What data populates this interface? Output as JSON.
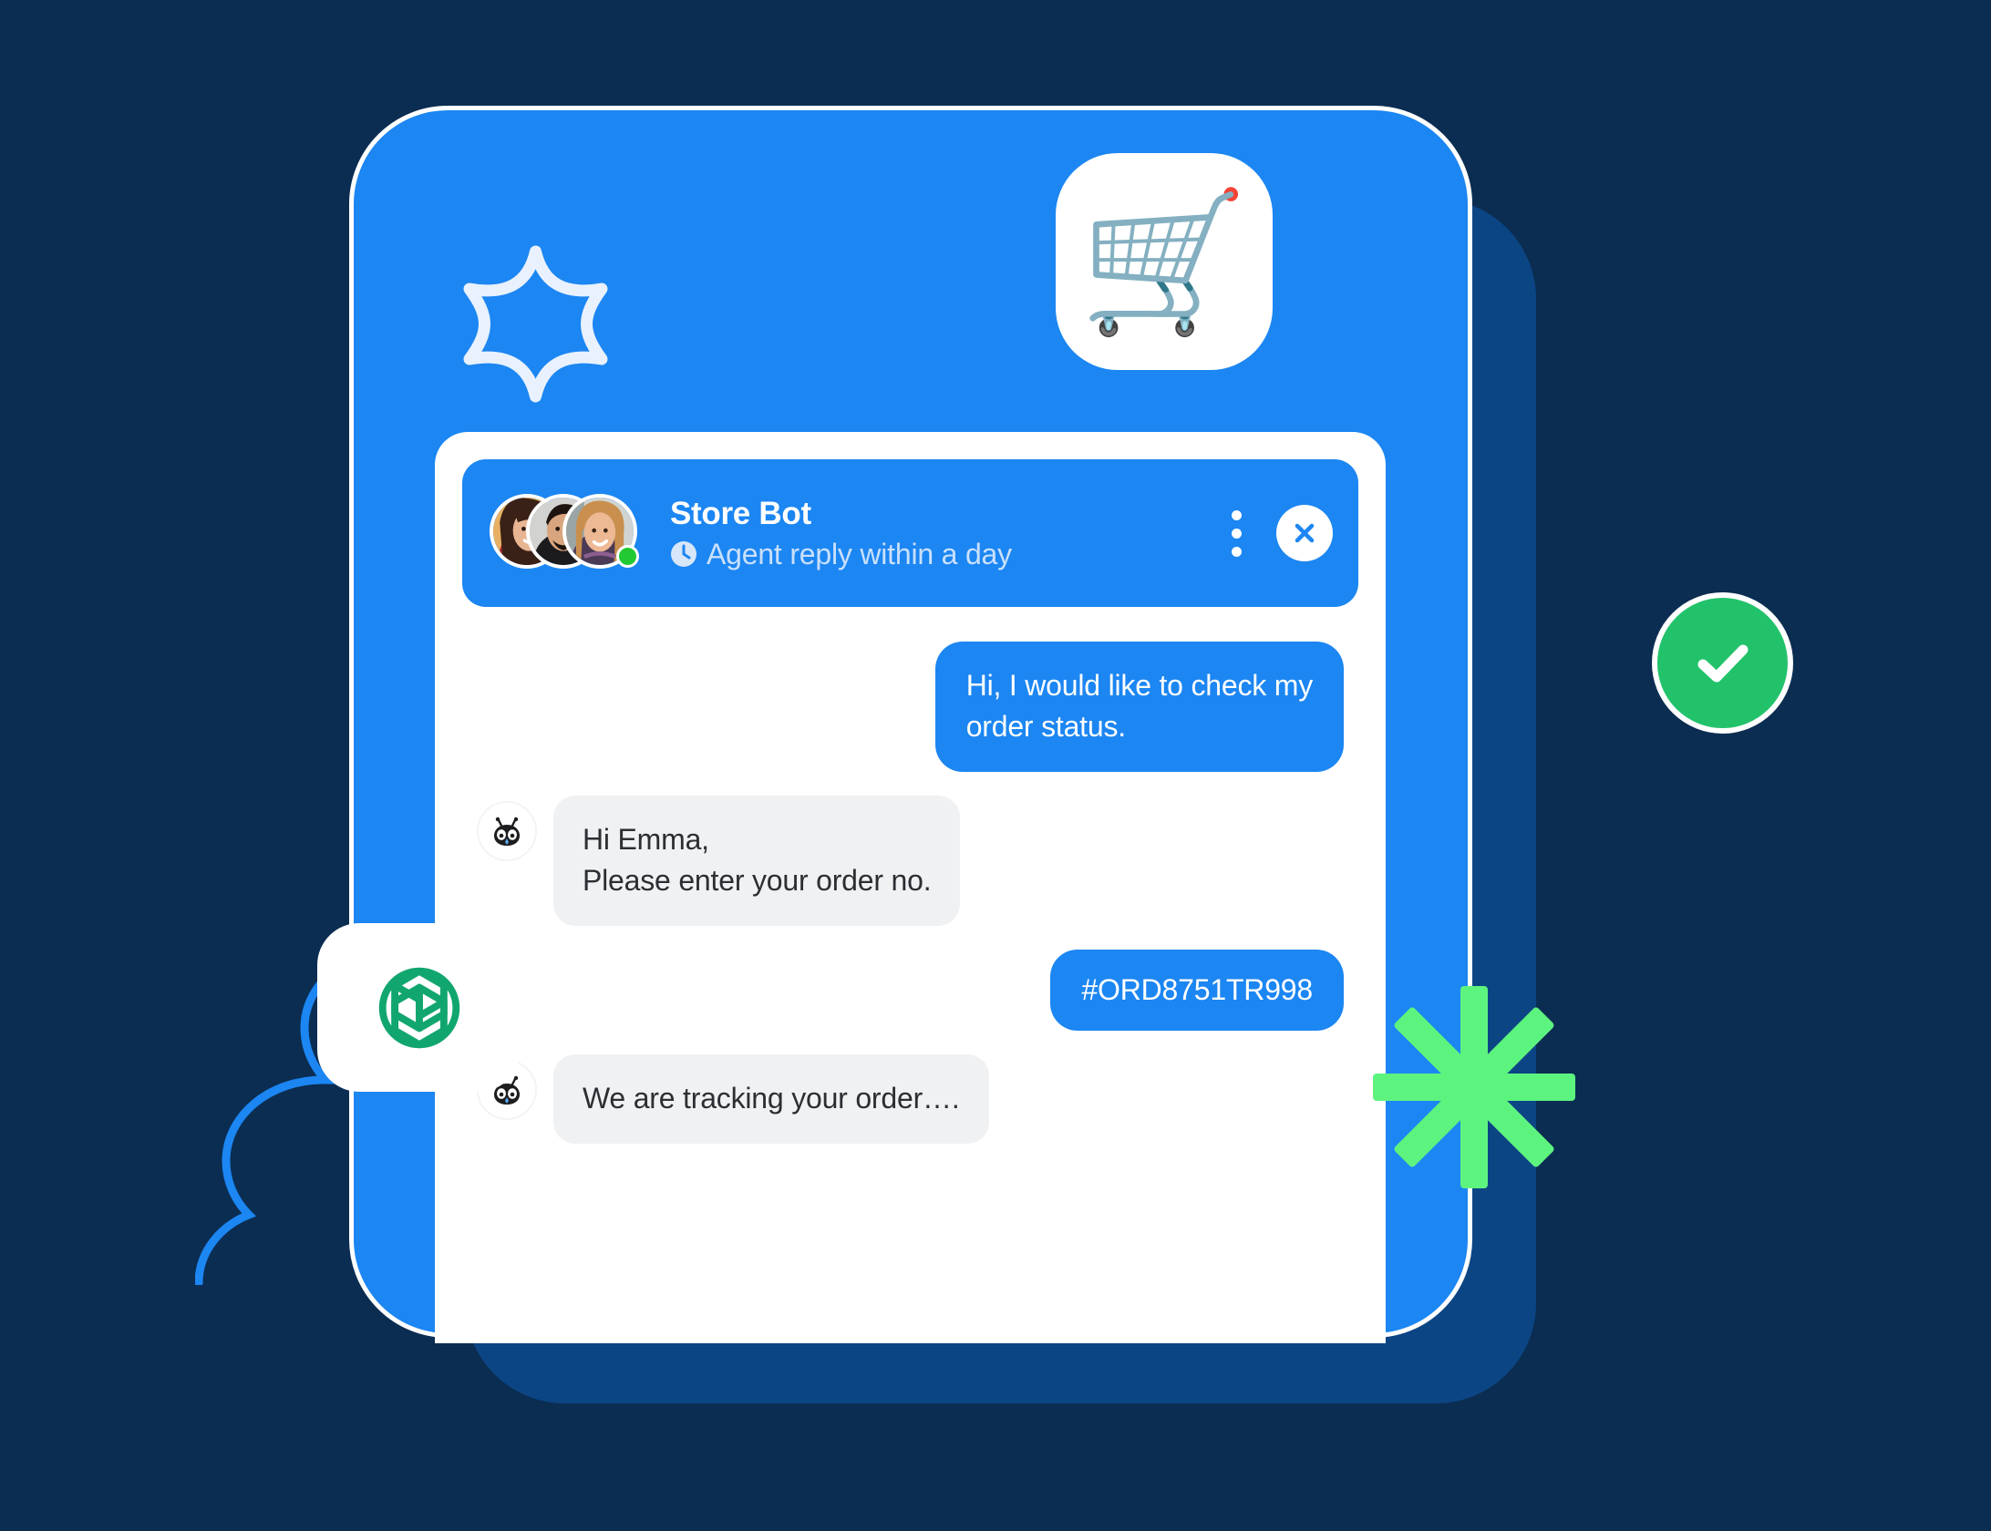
{
  "theme": {
    "page_background": "#0b2d52",
    "backdrop_card": "#0c4584",
    "primary_blue": "#1c86f2",
    "panel_white": "#ffffff",
    "incoming_bubble": "#f0f1f2",
    "incoming_text": "#2b2f33",
    "status_text": "#c9e0fb",
    "online_green": "#22c932",
    "check_green": "#22c26b",
    "asterisk_green": "#5df37f",
    "openai_green": "#10a37f"
  },
  "app_icon": {
    "name": "shopping-cart-icon",
    "glyph": "🛒"
  },
  "decorations": {
    "star_sparkle": "six-point-star-outline-icon",
    "cloud_outline": "scalloped-cloud-outline",
    "green_check": "check-circle-icon",
    "green_asterisk": "asterisk-sparkle-icon",
    "openai_logo": "openai-logo-icon"
  },
  "chat": {
    "header": {
      "bot_name": "Store Bot",
      "status_icon": "🕐",
      "status_text": "Agent reply within a day",
      "menu_label": "More options",
      "close_label": "Close chat",
      "avatars": [
        {
          "name": "avatar-agent-1",
          "alt": "Female agent with dark hair"
        },
        {
          "name": "avatar-agent-2",
          "alt": "Male agent with beard"
        },
        {
          "name": "avatar-agent-3",
          "alt": "Female agent with blonde hair"
        }
      ],
      "online": true
    },
    "messages": [
      {
        "id": "msg-1",
        "from": "user",
        "text": "Hi, I would like to check my\norder status."
      },
      {
        "id": "msg-2",
        "from": "bot",
        "text": "Hi Emma,\nPlease enter your order no.",
        "avatar": "bot-avatar-icon"
      },
      {
        "id": "msg-3",
        "from": "user",
        "text": "#ORD8751TR998"
      },
      {
        "id": "msg-4",
        "from": "bot",
        "text": "We are tracking your order….",
        "avatar": "bot-avatar-icon"
      }
    ]
  }
}
